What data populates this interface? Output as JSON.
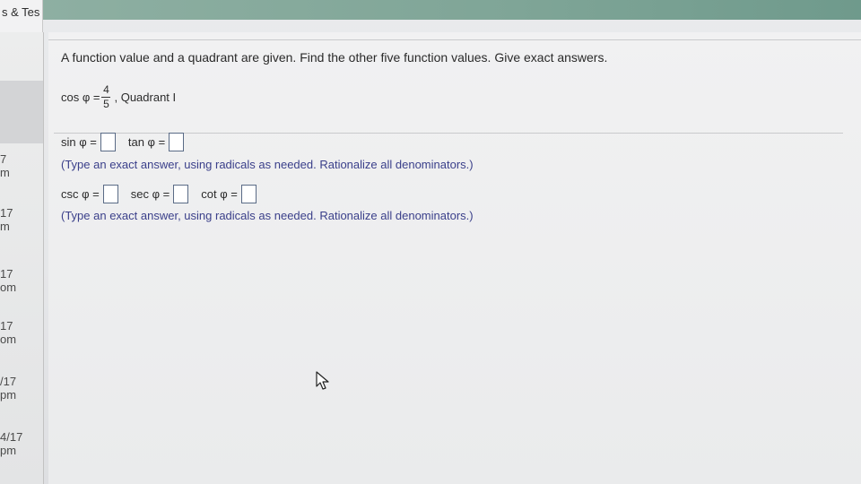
{
  "tab": {
    "label": "s & Tes"
  },
  "sidebar": {
    "items": [
      {
        "line1": "7",
        "line2": "m"
      },
      {
        "line1": "17",
        "line2": "m"
      },
      {
        "line1": "17",
        "line2": "om"
      },
      {
        "line1": "17",
        "line2": "om"
      },
      {
        "line1": "/17",
        "line2": "pm"
      },
      {
        "line1": "4/17",
        "line2": "pm"
      }
    ]
  },
  "question": {
    "instruction": "A function value and a quadrant are given. Find the other five function values. Give exact answers.",
    "given_prefix": "cos φ =",
    "given_numerator": "4",
    "given_denominator": "5",
    "given_suffix": ", Quadrant I"
  },
  "answers_row1": {
    "sin_label": "sin φ =",
    "tan_label": "tan φ =",
    "note": "(Type an exact answer, using radicals as needed. Rationalize all denominators.)"
  },
  "answers_row2": {
    "csc_label": "csc φ =",
    "sec_label": "sec φ =",
    "cot_label": "cot φ =",
    "note": "(Type an exact answer, using radicals as needed. Rationalize all denominators.)"
  },
  "colors": {
    "topbar": "#7fa597",
    "note_text": "#3a3f8a",
    "box_border": "#5a6b86"
  },
  "icons": {
    "cursor": "mouse-pointer-icon"
  }
}
